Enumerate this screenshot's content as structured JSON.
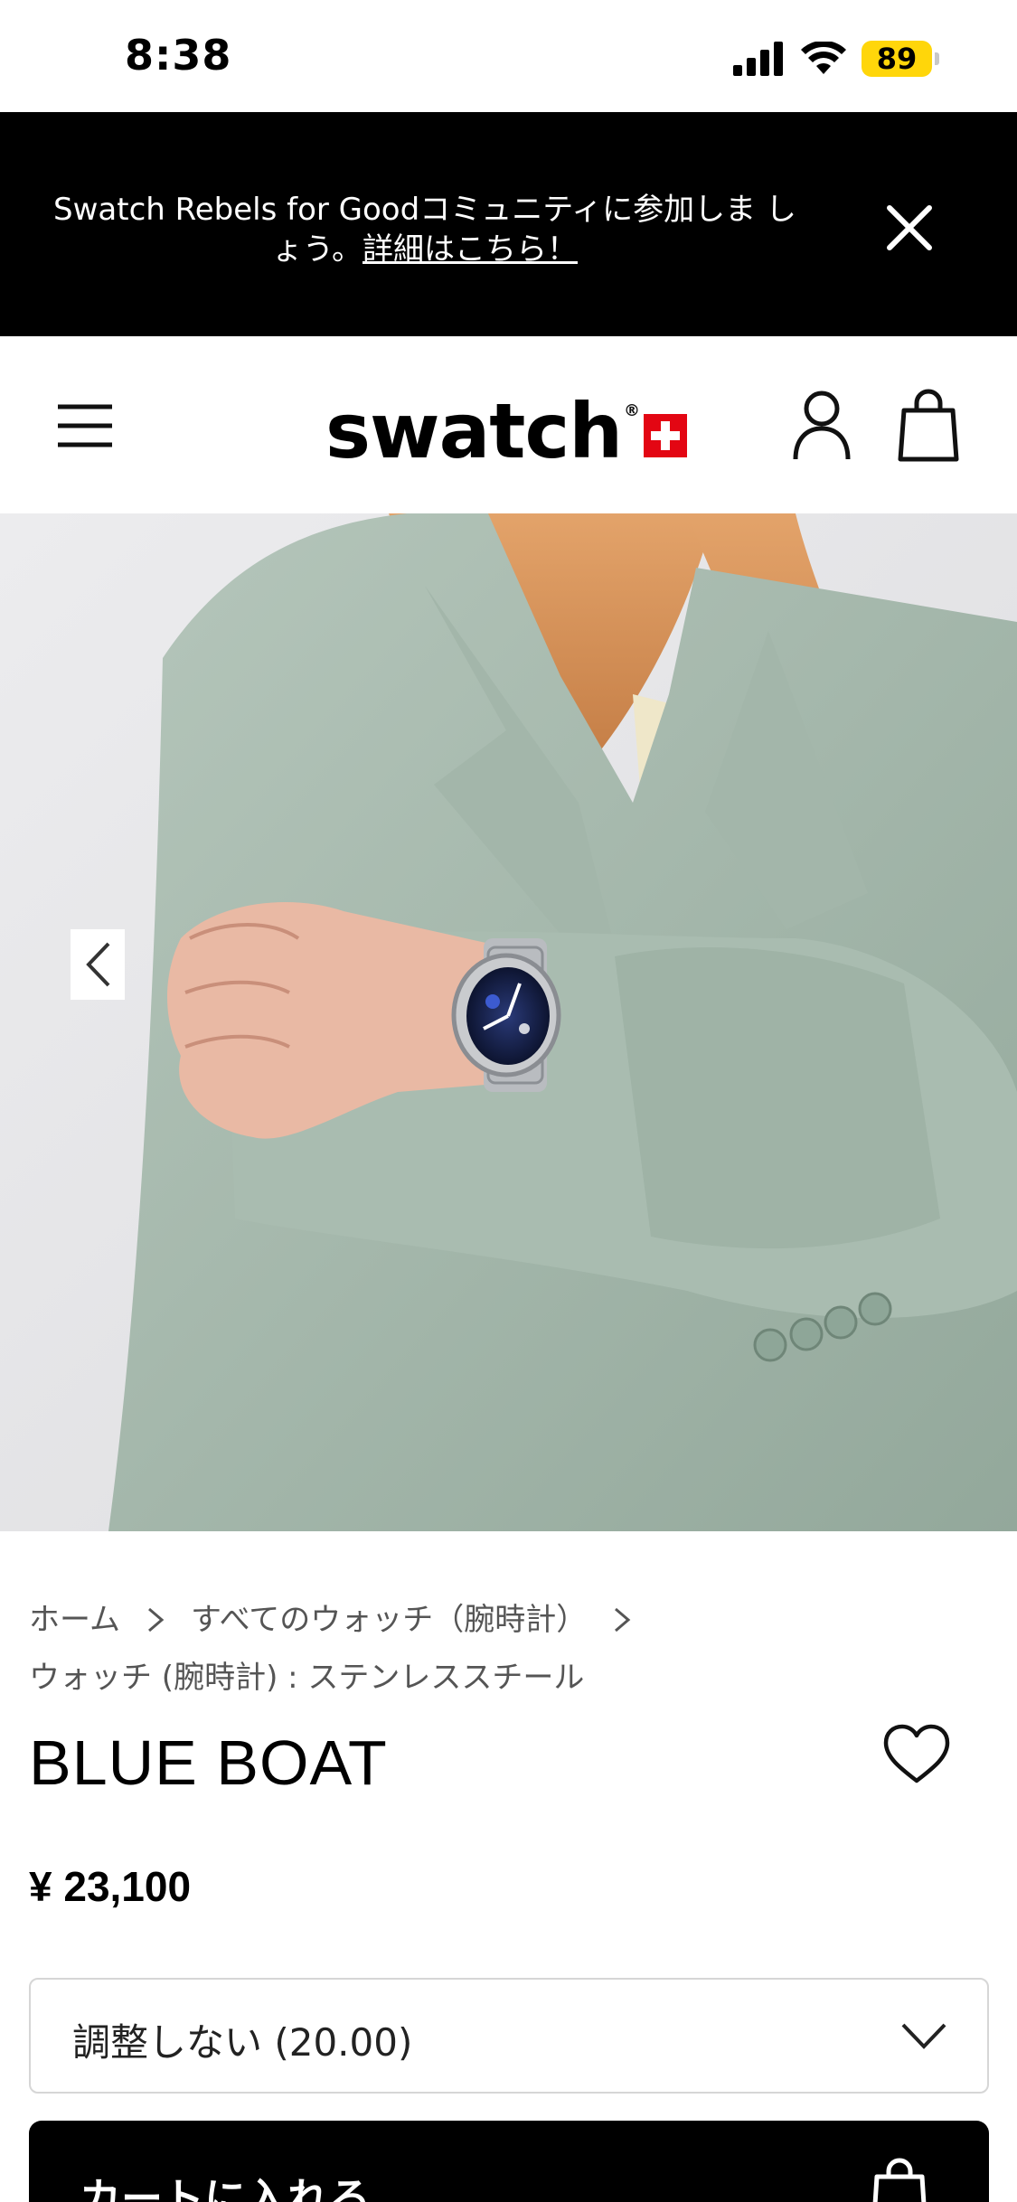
{
  "status_bar": {
    "time": "8:38",
    "battery": "89",
    "icons": [
      "cellular-signal-icon",
      "wifi-icon",
      "battery-icon"
    ]
  },
  "promo": {
    "text": "Swatch Rebels for Goodコミュニティに参加しま しょう。",
    "link": "詳細はこちら！",
    "close_icon": "close-icon"
  },
  "header": {
    "menu_icon": "hamburger-menu-icon",
    "logo": "swatch",
    "account_icon": "user-icon",
    "bag_icon": "shopping-bag-icon"
  },
  "hero": {
    "prev_icon": "chevron-left-icon"
  },
  "breadcrumb": {
    "home": "ホーム",
    "all_watches": "すべてのウォッチ（腕時計）",
    "category": "ウォッチ (腕時計) : ステンレススチール"
  },
  "product": {
    "title": "BLUE BOAT",
    "price": "¥ 23,100",
    "size_selected": "調整しない (20.00)",
    "add_to_cart": "カートに入れる"
  },
  "colors": {
    "banner_bg": "#000000",
    "battery": "#ffd60a",
    "swiss_red": "#e30613",
    "jacket": "#a9bcb0"
  }
}
